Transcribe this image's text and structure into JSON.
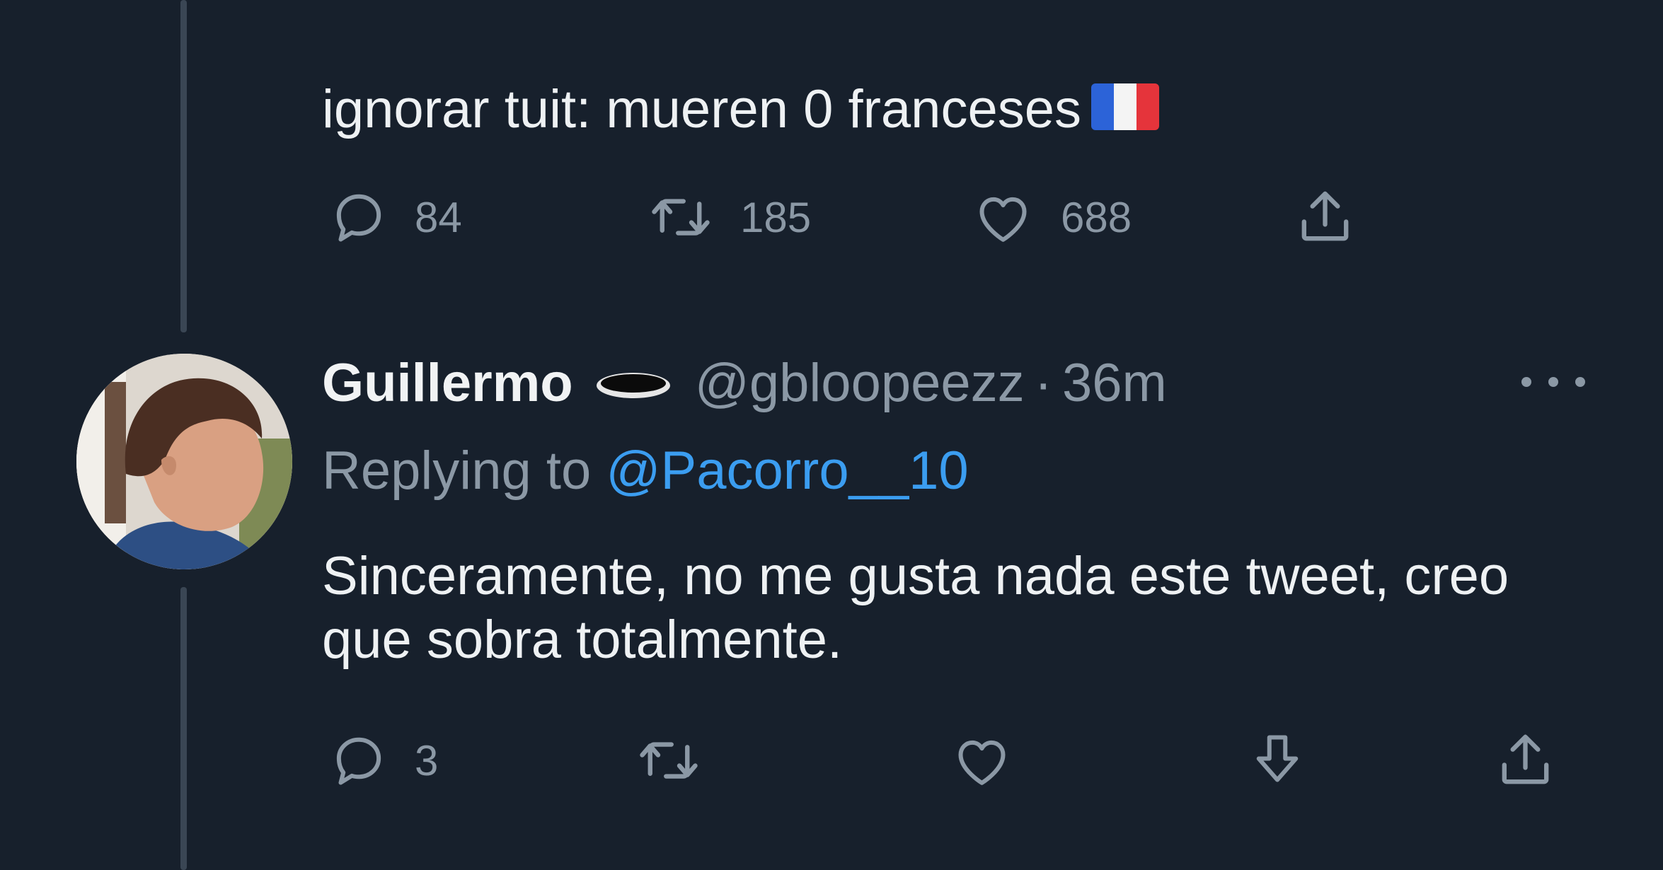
{
  "parent_tweet": {
    "text": "ignorar tuit: mueren 0 franceses",
    "flag_emoji": "france-flag",
    "actions": {
      "reply_count": "84",
      "retweet_count": "185",
      "like_count": "688"
    }
  },
  "reply_tweet": {
    "display_name": "Guillermo",
    "name_emoji": "hole-emoji",
    "handle": "@gbloopeezz",
    "separator": "·",
    "timestamp": "36m",
    "replying_prefix": "Replying to",
    "replying_to": "@Pacorro__10",
    "text": "Sinceramente, no me gusta nada este tweet, creo que sobra totalmente.",
    "actions": {
      "reply_count": "3"
    }
  },
  "colors": {
    "background": "#17202c",
    "text_primary": "#eef1f3",
    "text_secondary": "#8b98a5",
    "link": "#3b9df0",
    "thread_line": "#3a4654"
  }
}
